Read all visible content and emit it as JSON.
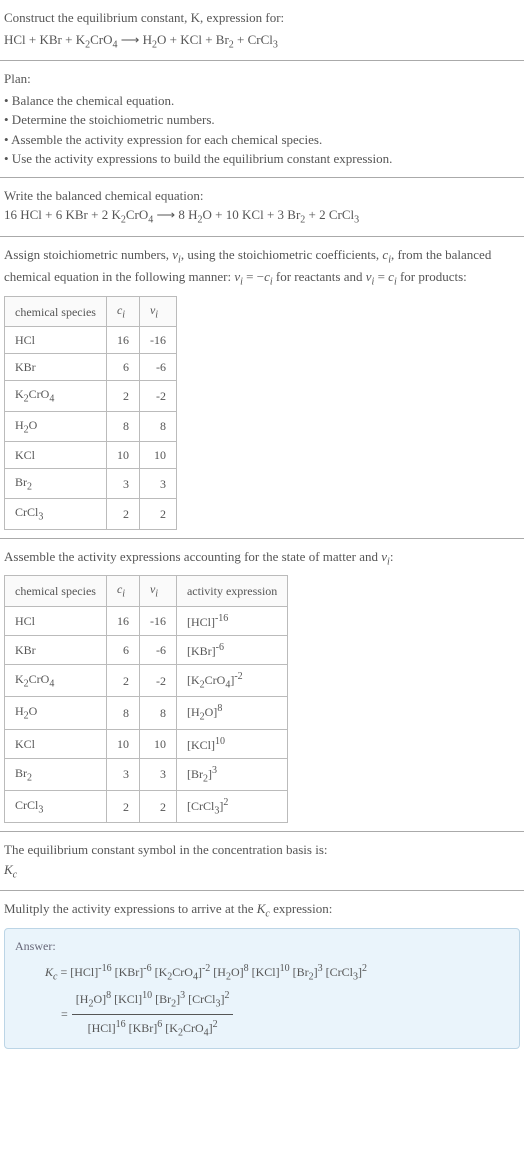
{
  "sec1": {
    "line1": "Construct the equilibrium constant, K, expression for:",
    "line2_html": "HCl + KBr + K<sub>2</sub>CrO<sub>4</sub> ⟶ H<sub>2</sub>O + KCl + Br<sub>2</sub> + CrCl<sub>3</sub>"
  },
  "sec2": {
    "title": "Plan:",
    "items": [
      "• Balance the chemical equation.",
      "• Determine the stoichiometric numbers.",
      "• Assemble the activity expression for each chemical species.",
      "• Use the activity expressions to build the equilibrium constant expression."
    ]
  },
  "sec3": {
    "line1": "Write the balanced chemical equation:",
    "line2_html": "16 HCl + 6 KBr + 2 K<sub>2</sub>CrO<sub>4</sub> ⟶ 8 H<sub>2</sub>O + 10 KCl + 3 Br<sub>2</sub> + 2 CrCl<sub>3</sub>"
  },
  "sec4": {
    "intro_html": "Assign stoichiometric numbers, <span class=\"italic\">ν<sub>i</sub></span>, using the stoichiometric coefficients, <span class=\"italic\">c<sub>i</sub></span>, from the balanced chemical equation in the following manner: <span class=\"italic\">ν<sub>i</sub></span> = −<span class=\"italic\">c<sub>i</sub></span> for reactants and <span class=\"italic\">ν<sub>i</sub></span> = <span class=\"italic\">c<sub>i</sub></span> for products:",
    "headers": {
      "species": "chemical species",
      "ci_html": "<span class=\"italic\">c<sub>i</sub></span>",
      "vi_html": "<span class=\"italic\">ν<sub>i</sub></span>"
    },
    "rows": [
      {
        "sp_html": "HCl",
        "c": "16",
        "v": "-16"
      },
      {
        "sp_html": "KBr",
        "c": "6",
        "v": "-6"
      },
      {
        "sp_html": "K<sub>2</sub>CrO<sub>4</sub>",
        "c": "2",
        "v": "-2"
      },
      {
        "sp_html": "H<sub>2</sub>O",
        "c": "8",
        "v": "8"
      },
      {
        "sp_html": "KCl",
        "c": "10",
        "v": "10"
      },
      {
        "sp_html": "Br<sub>2</sub>",
        "c": "3",
        "v": "3"
      },
      {
        "sp_html": "CrCl<sub>3</sub>",
        "c": "2",
        "v": "2"
      }
    ]
  },
  "sec5": {
    "intro_html": "Assemble the activity expressions accounting for the state of matter and <span class=\"italic\">ν<sub>i</sub></span>:",
    "headers": {
      "species": "chemical species",
      "ci_html": "<span class=\"italic\">c<sub>i</sub></span>",
      "vi_html": "<span class=\"italic\">ν<sub>i</sub></span>",
      "act": "activity expression"
    },
    "rows": [
      {
        "sp_html": "HCl",
        "c": "16",
        "v": "-16",
        "a_html": "[HCl]<sup>-16</sup>"
      },
      {
        "sp_html": "KBr",
        "c": "6",
        "v": "-6",
        "a_html": "[KBr]<sup>-6</sup>"
      },
      {
        "sp_html": "K<sub>2</sub>CrO<sub>4</sub>",
        "c": "2",
        "v": "-2",
        "a_html": "[K<sub>2</sub>CrO<sub>4</sub>]<sup>-2</sup>"
      },
      {
        "sp_html": "H<sub>2</sub>O",
        "c": "8",
        "v": "8",
        "a_html": "[H<sub>2</sub>O]<sup>8</sup>"
      },
      {
        "sp_html": "KCl",
        "c": "10",
        "v": "10",
        "a_html": "[KCl]<sup>10</sup>"
      },
      {
        "sp_html": "Br<sub>2</sub>",
        "c": "3",
        "v": "3",
        "a_html": "[Br<sub>2</sub>]<sup>3</sup>"
      },
      {
        "sp_html": "CrCl<sub>3</sub>",
        "c": "2",
        "v": "2",
        "a_html": "[CrCl<sub>3</sub>]<sup>2</sup>"
      }
    ]
  },
  "sec6": {
    "line1": "The equilibrium constant symbol in the concentration basis is:",
    "line2_html": "<span class=\"italic\">K<sub>c</sub></span>"
  },
  "sec7": {
    "intro_html": "Mulitply the activity expressions to arrive at the <span class=\"italic\">K<sub>c</sub></span> expression:",
    "answer_label": "Answer:",
    "kc1_html": "<span class=\"italic\">K<sub>c</sub></span> = [HCl]<sup>-16</sup> [KBr]<sup>-6</sup> [K<sub>2</sub>CrO<sub>4</sub>]<sup>-2</sup> [H<sub>2</sub>O]<sup>8</sup> [KCl]<sup>10</sup> [Br<sub>2</sub>]<sup>3</sup> [CrCl<sub>3</sub>]<sup>2</sup>",
    "kc2_eq": "=",
    "kc2_num_html": "[H<sub>2</sub>O]<sup>8</sup> [KCl]<sup>10</sup> [Br<sub>2</sub>]<sup>3</sup> [CrCl<sub>3</sub>]<sup>2</sup>",
    "kc2_den_html": "[HCl]<sup>16</sup> [KBr]<sup>6</sup> [K<sub>2</sub>CrO<sub>4</sub>]<sup>2</sup>"
  }
}
